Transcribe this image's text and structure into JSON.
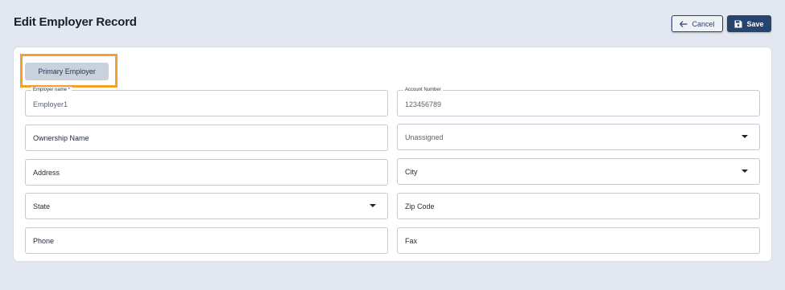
{
  "header": {
    "title": "Edit Employer Record",
    "cancel_label": "Cancel",
    "save_label": "Save"
  },
  "tabs": {
    "primary_label": "Primary Employer"
  },
  "form": {
    "employer_name": {
      "label": "Employer name *",
      "value": "Employer1"
    },
    "account_number": {
      "label": "Account Number",
      "value": "123456789"
    },
    "ownership_name": {
      "placeholder": "Ownership Name"
    },
    "assignment": {
      "value": "Unassigned"
    },
    "address": {
      "placeholder": "Address"
    },
    "city": {
      "placeholder": "City"
    },
    "state": {
      "placeholder": "State"
    },
    "zip_code": {
      "placeholder": "Zip Code"
    },
    "phone": {
      "placeholder": "Phone"
    },
    "fax": {
      "placeholder": "Fax"
    }
  },
  "colors": {
    "page_bg": "#e3e8f0",
    "primary": "#27446e",
    "highlight": "#f2a22b",
    "tab_bg": "#c9d1dd"
  },
  "icons": {
    "cancel": "arrow-left-icon",
    "save": "floppy-disk-icon",
    "dropdown": "caret-down-icon"
  }
}
